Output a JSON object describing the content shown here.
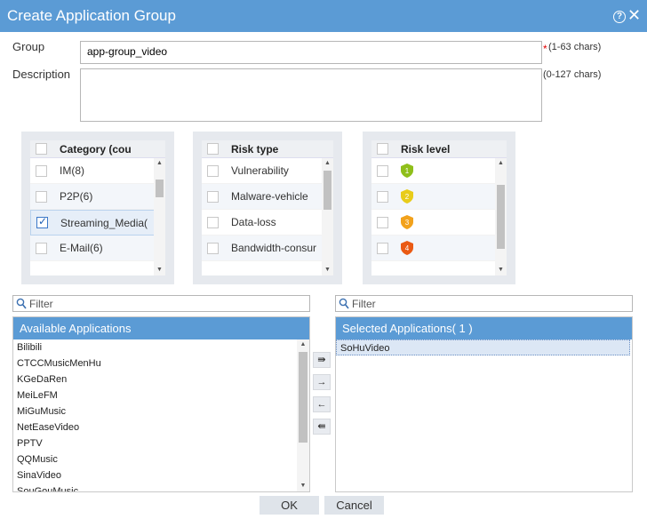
{
  "dialog": {
    "title": "Create Application Group"
  },
  "form": {
    "group_label": "Group",
    "group_value": "app-group_video",
    "group_hint": "(1-63 chars)",
    "required_mark": "*",
    "description_label": "Description",
    "description_value": "",
    "description_hint": "(0-127 chars)"
  },
  "category_panel": {
    "header": "Category (cou",
    "rows": [
      {
        "label": "IM(8)",
        "checked": false
      },
      {
        "label": "P2P(6)",
        "checked": false
      },
      {
        "label": "Streaming_Media(",
        "checked": true
      },
      {
        "label": "E-Mail(6)",
        "checked": false
      }
    ]
  },
  "risk_type_panel": {
    "header": "Risk type",
    "rows": [
      {
        "label": "Vulnerability",
        "checked": false
      },
      {
        "label": "Malware-vehicle",
        "checked": false
      },
      {
        "label": "Data-loss",
        "checked": false
      },
      {
        "label": "Bandwidth-consur",
        "checked": false
      }
    ]
  },
  "risk_level_panel": {
    "header": "Risk level",
    "rows": [
      {
        "level": "1",
        "color": "#8fbf1a",
        "checked": false
      },
      {
        "level": "2",
        "color": "#e8cc1a",
        "checked": false
      },
      {
        "level": "3",
        "color": "#f2a21c",
        "checked": false
      },
      {
        "level": "4",
        "color": "#ea5a14",
        "checked": false
      }
    ]
  },
  "available": {
    "filter_placeholder": "Filter",
    "header": "Available Applications",
    "items": [
      "Bilibili",
      "CTCCMusicMenHu",
      "KGeDaRen",
      "MeiLeFM",
      "MiGuMusic",
      "NetEaseVideo",
      "PPTV",
      "QQMusic",
      "SinaVideo",
      "SouGouMusic"
    ]
  },
  "selected": {
    "filter_placeholder": "Filter",
    "header": "Selected Applications( 1 )",
    "items": [
      "SoHuVideo"
    ]
  },
  "buttons": {
    "ok": "OK",
    "cancel": "Cancel"
  },
  "colors": {
    "accent": "#5b9bd5",
    "required": "#e00000"
  }
}
